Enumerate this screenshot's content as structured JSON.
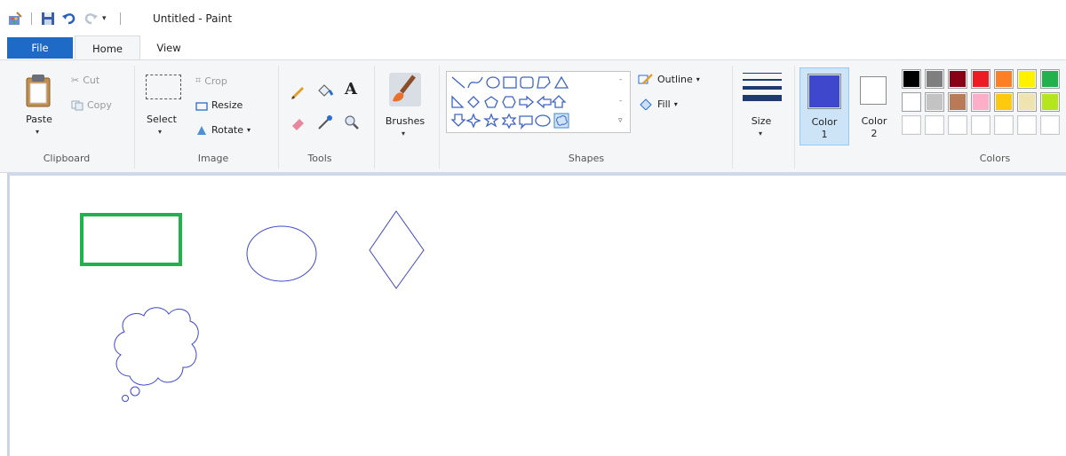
{
  "window": {
    "title": "Untitled - Paint"
  },
  "quick_access": {
    "icons": [
      "paint-app-icon",
      "save-icon",
      "undo-icon",
      "redo-icon",
      "customize-dropdown-icon"
    ]
  },
  "tabs": [
    {
      "label": "File"
    },
    {
      "label": "Home"
    },
    {
      "label": "View"
    }
  ],
  "clipboard": {
    "paste_label": "Paste",
    "cut_label": "Cut",
    "copy_label": "Copy",
    "group_label": "Clipboard"
  },
  "image": {
    "select_label": "Select",
    "crop_label": "Crop",
    "resize_label": "Resize",
    "rotate_label": "Rotate",
    "group_label": "Image"
  },
  "tools": {
    "group_label": "Tools",
    "text_tool_glyph": "A"
  },
  "brushes": {
    "label": "Brushes"
  },
  "shapes": {
    "outline_label": "Outline",
    "fill_label": "Fill",
    "group_label": "Shapes",
    "selected_shape": "cloud-callout"
  },
  "size": {
    "label": "Size"
  },
  "colors": {
    "color1_label": "Color",
    "color1_number": "1",
    "color2_label": "Color",
    "color2_number": "2",
    "group_label": "Colors",
    "color1_value": "#3f48cc",
    "color2_value": "#ffffff",
    "palette_row1": [
      "#000000",
      "#7f7f7f",
      "#880015",
      "#ed1c24",
      "#ff7f27",
      "#fff200",
      "#22b14c"
    ],
    "palette_row2": [
      "#ffffff",
      "#c3c3c3",
      "#b97a57",
      "#ffaec9",
      "#ffc90e",
      "#efe4b0",
      "#b5e61d"
    ],
    "palette_row3": [
      "#ffffff",
      "#ffffff",
      "#ffffff",
      "#ffffff",
      "#ffffff",
      "#ffffff",
      "#ffffff"
    ]
  },
  "drawing": {
    "shapes": [
      "rectangle",
      "ellipse",
      "diamond",
      "cloud-callout"
    ],
    "rectangle_color": "#22b14c",
    "shape_color": "#3f48cc"
  }
}
